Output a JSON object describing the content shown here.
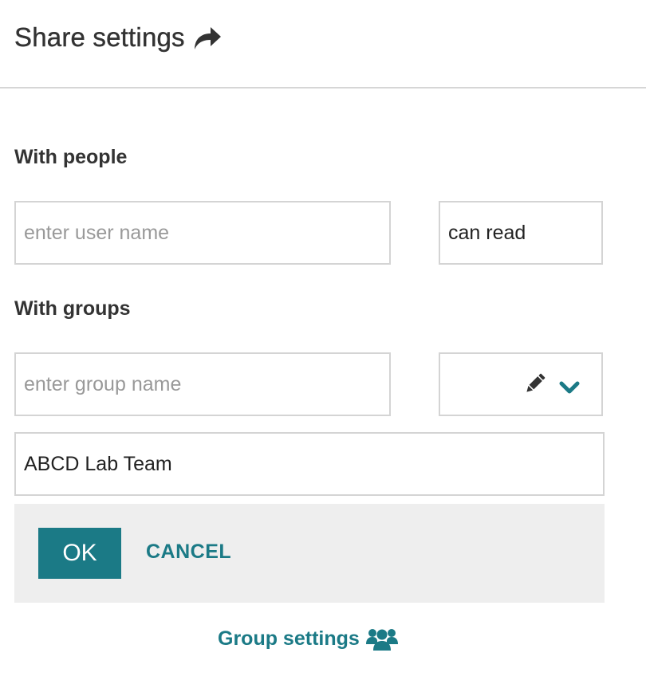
{
  "header": {
    "title": "Share settings",
    "icon": "share-icon"
  },
  "people": {
    "label": "With people",
    "user_input": {
      "placeholder": "enter user name",
      "value": ""
    },
    "permission": "can read"
  },
  "groups": {
    "label": "With groups",
    "group_input": {
      "placeholder": "enter group name",
      "value": ""
    },
    "permission_icons": [
      "pencil-icon",
      "chevron-down-icon"
    ],
    "selected_group": "ABCD Lab Team"
  },
  "actions": {
    "ok_label": "OK",
    "cancel_label": "CANCEL"
  },
  "footer": {
    "group_settings_label": "Group settings",
    "icon": "users-icon"
  },
  "colors": {
    "accent": "#1b7a86",
    "panel_background": "#eeeeee",
    "border": "#d4d4d4",
    "text": "#333333",
    "placeholder": "#999999"
  }
}
